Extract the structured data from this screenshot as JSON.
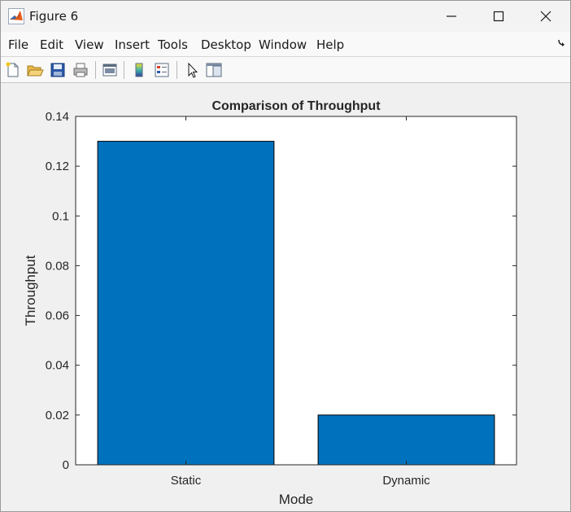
{
  "window": {
    "title": "Figure 6",
    "controls": [
      "minimize-icon",
      "maximize-icon",
      "close-icon"
    ]
  },
  "menu": {
    "items": [
      "File",
      "Edit",
      "View",
      "Insert",
      "Tools",
      "Desktop",
      "Window",
      "Help"
    ]
  },
  "toolbar": {
    "icons": [
      "new-figure-icon",
      "open-file-icon",
      "save-icon",
      "print-icon",
      "link-plot-icon",
      "colorbar-icon",
      "legend-icon",
      "edit-plot-icon",
      "property-inspector-icon"
    ]
  },
  "colors": {
    "bar": "#0072BD",
    "bar_edge": "#000000",
    "axes_background": "#FFFFFF",
    "figure_background": "#F0F0F0"
  },
  "chart_data": {
    "type": "bar",
    "title": "Comparison of Throughput",
    "xlabel": "Mode",
    "ylabel": "Throughput",
    "categories": [
      "Static",
      "Dynamic"
    ],
    "values": [
      0.13,
      0.02
    ],
    "ylim": [
      0,
      0.14
    ],
    "xlim": [
      0.5,
      2.5
    ],
    "yticks": [
      "0",
      "0.02",
      "0.04",
      "0.06",
      "0.08",
      "0.1",
      "0.12",
      "0.14"
    ],
    "grid": false,
    "legend": "none"
  }
}
